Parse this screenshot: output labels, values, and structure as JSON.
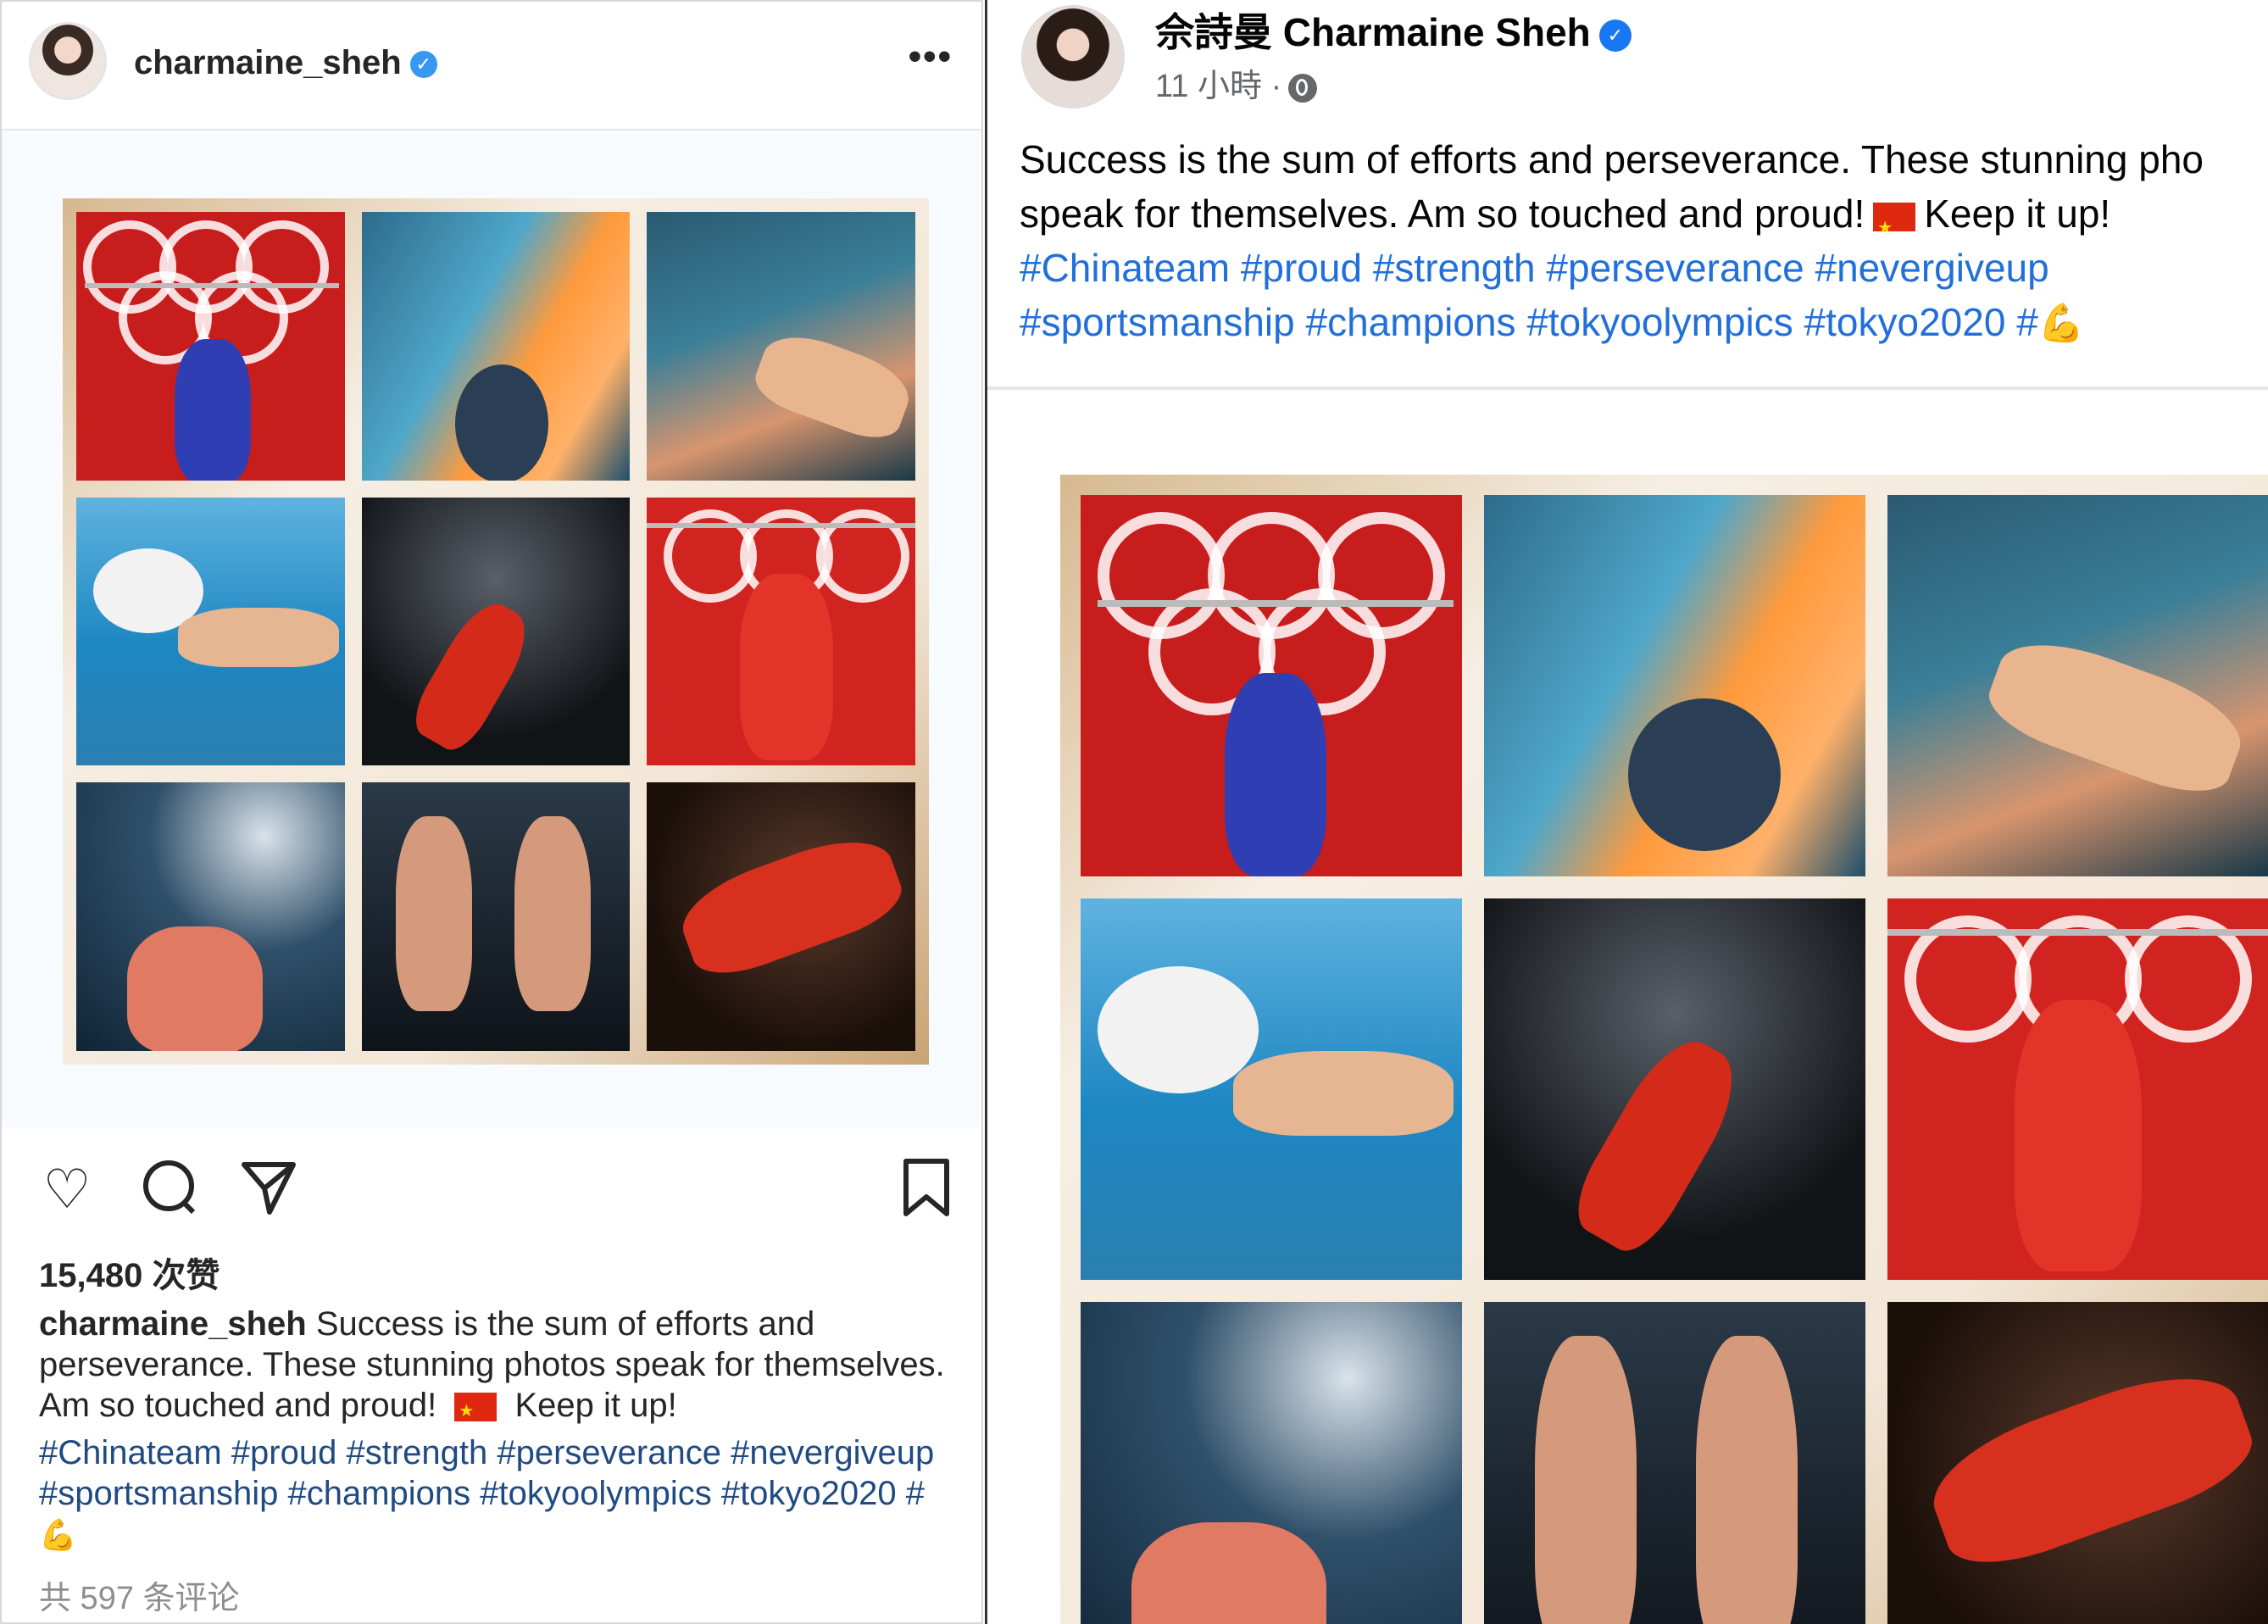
{
  "instagram": {
    "username": "charmaine_sheh",
    "verified_icon": "verified-badge-icon",
    "more_label": "•••",
    "likes": "15,480 次赞",
    "caption_user": "charmaine_sheh",
    "caption_text_1": "Success is the sum of efforts and perseverance. These stunning photos speak for themselves. Am so touched and proud!",
    "caption_text_2": "Keep it up!",
    "hashtags": "#Chinateam #proud #strength #perseverance #nevergiveup #sportsmanship #champions #tokyoolympics #tokyo2020 #",
    "comments": "共 597 条评论"
  },
  "facebook": {
    "name": "佘詩曼 Charmaine Sheh",
    "time": "11 小時 ·",
    "text_line_1": "Success is the sum of efforts and perseverance. These stunning pho",
    "text_line_2_a": "speak for themselves. Am so touched and proud!",
    "text_line_2_b": "Keep it up!",
    "hashtags": "#Chinateam #proud #strength #perseverance #nevergiveup #sportsmanship #champions #tokyoolympics #tokyo2020 #"
  },
  "colors": {
    "ig_link": "#1f4a82",
    "fb_link": "#216fdb",
    "verified": "#3897f0",
    "flag_red": "#de2910"
  },
  "icons": [
    "heart-icon",
    "comment-icon",
    "share-icon",
    "bookmark-icon",
    "globe-icon",
    "flexed-biceps-icon",
    "china-flag-icon"
  ]
}
